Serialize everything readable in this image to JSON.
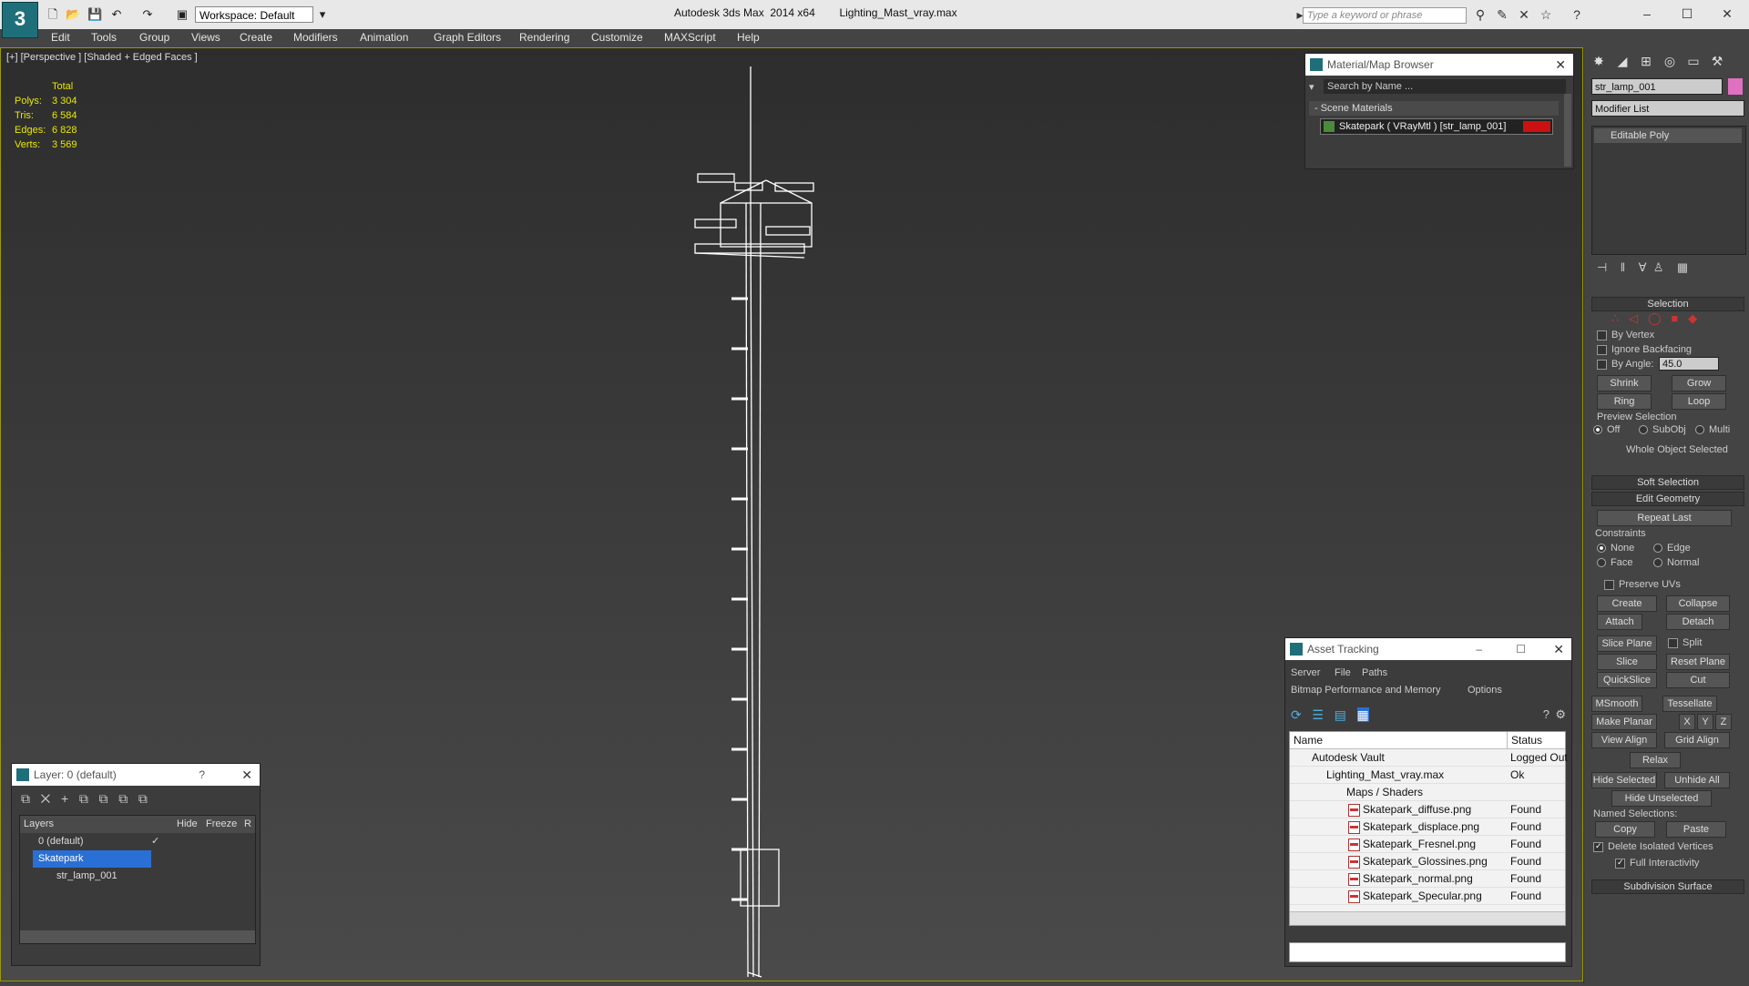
{
  "titlebar": {
    "workspace": "Workspace: Default",
    "app_title": "Autodesk 3ds Max  2014 x64",
    "file_title": "Lighting_Mast_vray.max",
    "search_placeholder": "Type a keyword or phrase"
  },
  "menu": [
    "Edit",
    "Tools",
    "Group",
    "Views",
    "Create",
    "Modifiers",
    "Animation",
    "Graph Editors",
    "Rendering",
    "Customize",
    "MAXScript",
    "Help"
  ],
  "viewport": {
    "label": "[+] [Perspective ] [Shaded + Edged Faces ]",
    "stats_header": "Total",
    "stats": [
      {
        "label": "Polys:",
        "value": "3 304"
      },
      {
        "label": "Tris:",
        "value": "6 584"
      },
      {
        "label": "Edges:",
        "value": "6 828"
      },
      {
        "label": "Verts:",
        "value": "3 569"
      }
    ]
  },
  "material_browser": {
    "title": "Material/Map Browser",
    "search_placeholder": "Search by Name ...",
    "section": "- Scene Materials",
    "item": "Skatepark  ( VRayMtl ) [str_lamp_001]",
    "item_color": "#cc1111"
  },
  "layer_panel": {
    "title": "Layer: 0 (default)",
    "help": "?",
    "columns": [
      "Layers",
      "Hide",
      "Freeze",
      "R"
    ],
    "rows": [
      {
        "name": "0 (default)",
        "check": "✓"
      },
      {
        "name": "Skatepark",
        "check": ""
      },
      {
        "name": "str_lamp_001",
        "check": ""
      }
    ]
  },
  "asset_tracking": {
    "title": "Asset Tracking",
    "menu1": [
      "Server",
      "File",
      "Paths"
    ],
    "menu2": [
      "Bitmap Performance and Memory",
      "Options"
    ],
    "columns": [
      "Name",
      "Status"
    ],
    "rows": [
      {
        "name": "Autodesk Vault",
        "status": "Logged Out"
      },
      {
        "name": "Lighting_Mast_vray.max",
        "status": "Ok"
      },
      {
        "name": "Maps / Shaders",
        "status": ""
      },
      {
        "name": "Skatepark_diffuse.png",
        "status": "Found"
      },
      {
        "name": "Skatepark_displace.png",
        "status": "Found"
      },
      {
        "name": "Skatepark_Fresnel.png",
        "status": "Found"
      },
      {
        "name": "Skatepark_Glossines.png",
        "status": "Found"
      },
      {
        "name": "Skatepark_normal.png",
        "status": "Found"
      },
      {
        "name": "Skatepark_Specular.png",
        "status": "Found"
      }
    ]
  },
  "command_panel": {
    "object_name": "str_lamp_001",
    "object_color": "#e070c0",
    "modifier_list": "Modifier List",
    "stack_item": "Editable Poly",
    "selection": {
      "header": "Selection",
      "by_vertex": "By Vertex",
      "ignore_backfacing": "Ignore Backfacing",
      "by_angle": "By Angle:",
      "angle_value": "45.0",
      "shrink": "Shrink",
      "grow": "Grow",
      "ring": "Ring",
      "loop": "Loop",
      "preview_selection": "Preview Selection",
      "off": "Off",
      "subobj": "SubObj",
      "multi": "Multi",
      "status": "Whole Object Selected"
    },
    "soft_selection": "Soft Selection",
    "edit_geometry": {
      "header": "Edit Geometry",
      "repeat_last": "Repeat Last",
      "constraints": "Constraints",
      "none": "None",
      "edge": "Edge",
      "face": "Face",
      "normal": "Normal",
      "preserve_uvs": "Preserve UVs",
      "create": "Create",
      "collapse": "Collapse",
      "attach": "Attach",
      "detach": "Detach",
      "slice_plane": "Slice Plane",
      "split": "Split",
      "slice": "Slice",
      "reset_plane": "Reset Plane",
      "quickslice": "QuickSlice",
      "cut": "Cut",
      "msmooth": "MSmooth",
      "tessellate": "Tessellate",
      "make_planar": "Make Planar",
      "x": "X",
      "y": "Y",
      "z": "Z",
      "view_align": "View Align",
      "grid_align": "Grid Align",
      "relax": "Relax",
      "hide_selected": "Hide Selected",
      "unhide_all": "Unhide All",
      "hide_unselected": "Hide Unselected",
      "named_selections": "Named Selections:",
      "copy": "Copy",
      "paste": "Paste",
      "delete_isolated": "Delete Isolated Vertices",
      "full_interactivity": "Full Interactivity"
    },
    "subdivision_surface": "Subdivision Surface"
  }
}
